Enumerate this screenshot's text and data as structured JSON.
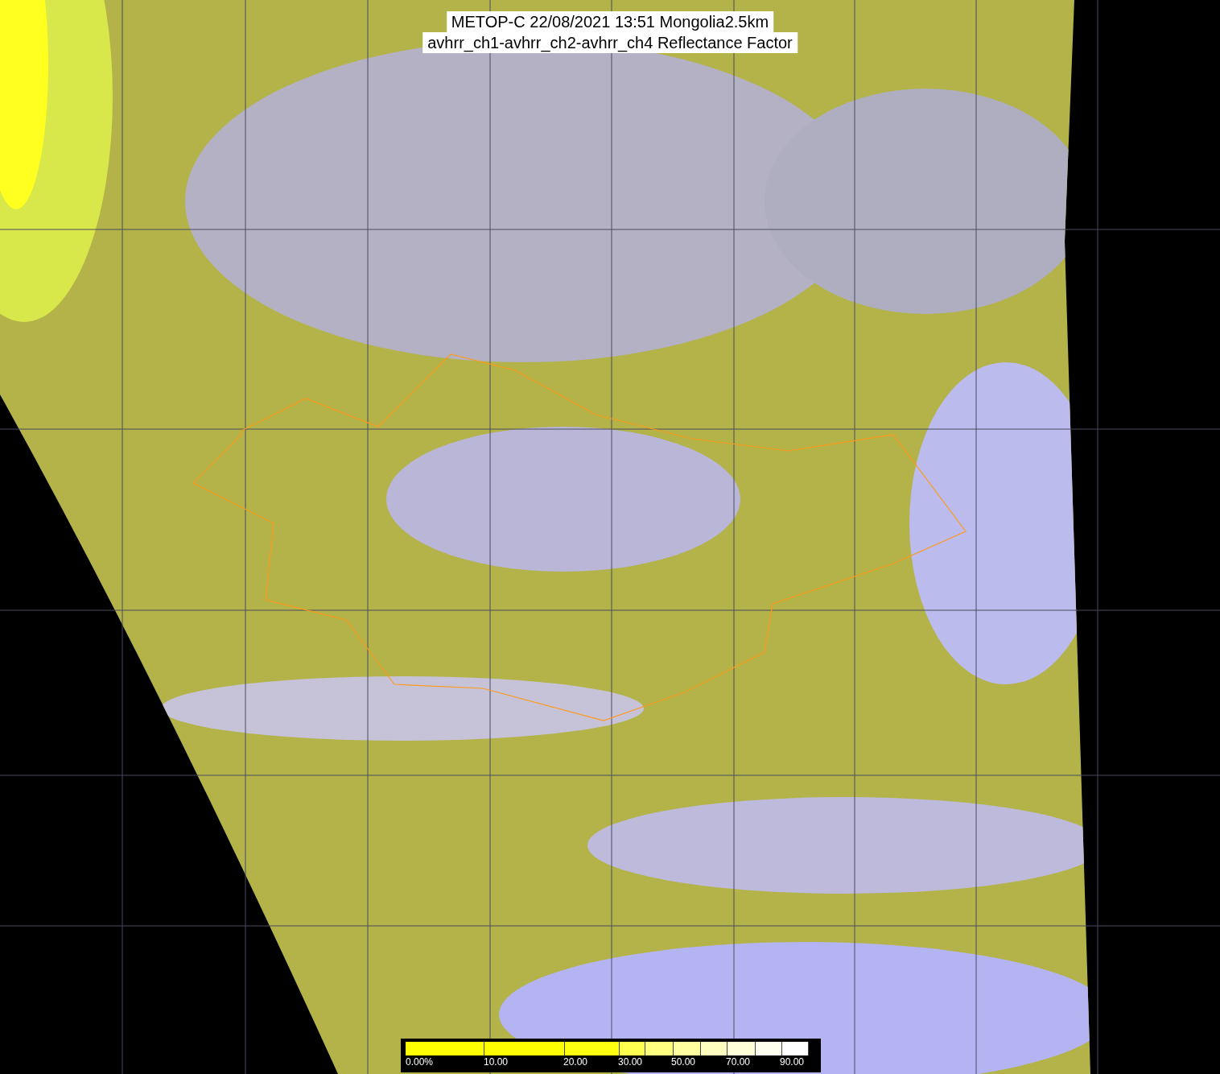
{
  "title": {
    "line1": "METOP-C 22/08/2021 13:51 Mongolia2.5km",
    "line2": "avhrr_ch1-avhrr_ch2-avhrr_ch4 Reflectance Factor"
  },
  "legend": {
    "labels": [
      "0.00%",
      "10.00",
      "20.00",
      "30.00",
      "50.00",
      "70.00",
      "90.00"
    ]
  }
}
